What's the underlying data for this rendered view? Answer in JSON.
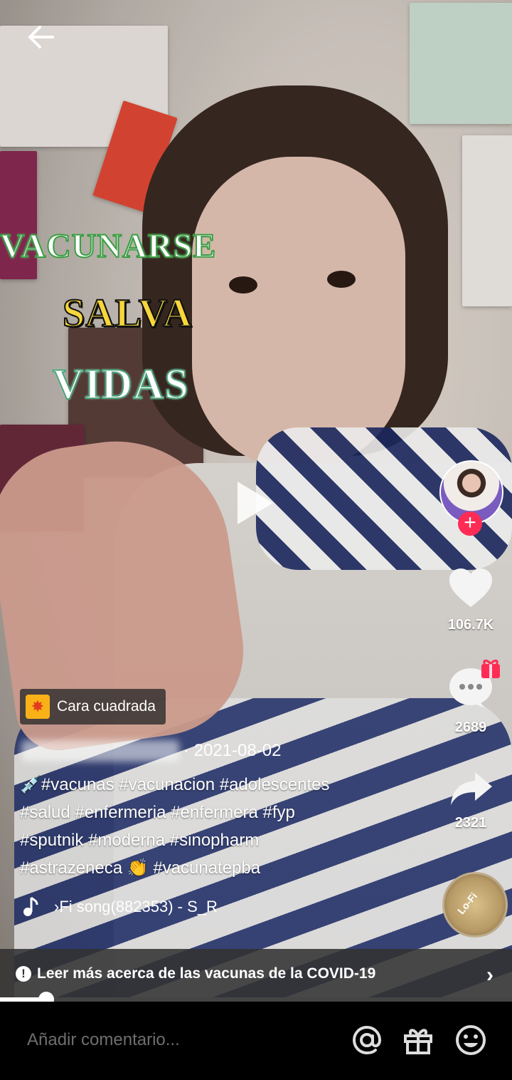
{
  "nav": {
    "back_icon": "arrow-left-icon"
  },
  "overlay": {
    "line1": "VACUNARSE",
    "line2": "SALVA",
    "line3": "VIDAS"
  },
  "actions": {
    "likes": "106.7K",
    "comments": "2689",
    "shares": "2321",
    "follow_symbol": "+",
    "sound_label": "Lo-Fi"
  },
  "effect": {
    "label": "Cara cuadrada"
  },
  "post": {
    "date": "· 2021-08-02",
    "caption_lines": [
      "💉#vacunas #vacunacion #adolescentes",
      "#salud #enfermeria #enfermera #fyp",
      "#sputnik #moderna #sinopharm",
      "#astrazeneca 👏 #vacunatepba"
    ],
    "music": "›Fi song(882353) - S_R"
  },
  "banner": {
    "text": "Leer más acerca de las vacunas de la COVID-19",
    "icon": "!"
  },
  "progress": {
    "fraction": 0.09
  },
  "comment_bar": {
    "placeholder": "Añadir comentario..."
  },
  "colors": {
    "accent": "#fe2c55",
    "banner_bg": "#323232"
  }
}
